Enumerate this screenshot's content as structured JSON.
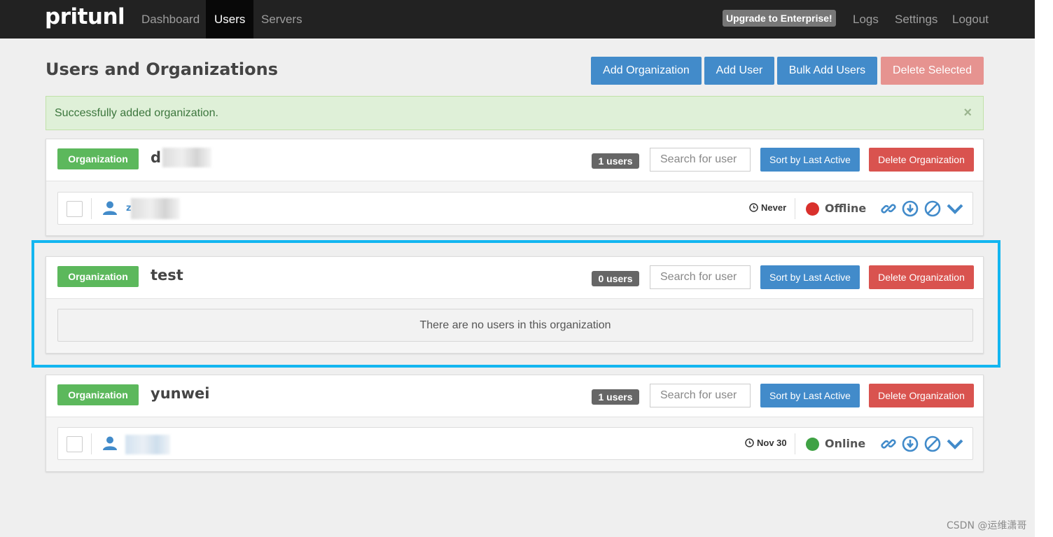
{
  "navbar": {
    "brand": "pritunl",
    "links": [
      "Dashboard",
      "Users",
      "Servers"
    ],
    "active": "Users",
    "upgrade_label": "Upgrade to Enterprise!",
    "right_links": [
      "Logs",
      "Settings",
      "Logout"
    ]
  },
  "header": {
    "title": "Users and Organizations",
    "buttons": {
      "add_org": "Add Organization",
      "add_user": "Add User",
      "bulk_add": "Bulk Add Users",
      "delete_selected": "Delete Selected"
    }
  },
  "alert": {
    "message": "Successfully added organization.",
    "close": "×"
  },
  "organizations": [
    {
      "label": "Organization",
      "name": "d",
      "count": "1 users",
      "search_placeholder": "Search for user",
      "sort_label": "Sort by Last Active",
      "delete_label": "Delete Organization",
      "users": [
        {
          "name": "z",
          "last_active": "Never",
          "status": "Offline",
          "status_color": "#d9302c"
        }
      ]
    },
    {
      "label": "Organization",
      "name": "test",
      "count": "0 users",
      "search_placeholder": "Search for user",
      "sort_label": "Sort by Last Active",
      "delete_label": "Delete Organization",
      "empty_message": "There are no users in this organization"
    },
    {
      "label": "Organization",
      "name": "yunwei",
      "count": "1 users",
      "search_placeholder": "Search for user",
      "sort_label": "Sort by Last Active",
      "delete_label": "Delete Organization",
      "users": [
        {
          "name": "",
          "last_active": "Nov 30",
          "status": "Online",
          "status_color": "#3fa244"
        }
      ]
    }
  ],
  "icons": {
    "user": "user-icon",
    "clock": "clock-icon",
    "link": "link-icon",
    "download": "download-icon",
    "disable": "disable-icon",
    "expand": "chevron-down-icon"
  },
  "colors": {
    "accent": "#428bca",
    "danger": "#d9534f",
    "success": "#5cb85c",
    "highlight": "#13b6f0"
  },
  "watermark": "CSDN @运维潇哥"
}
